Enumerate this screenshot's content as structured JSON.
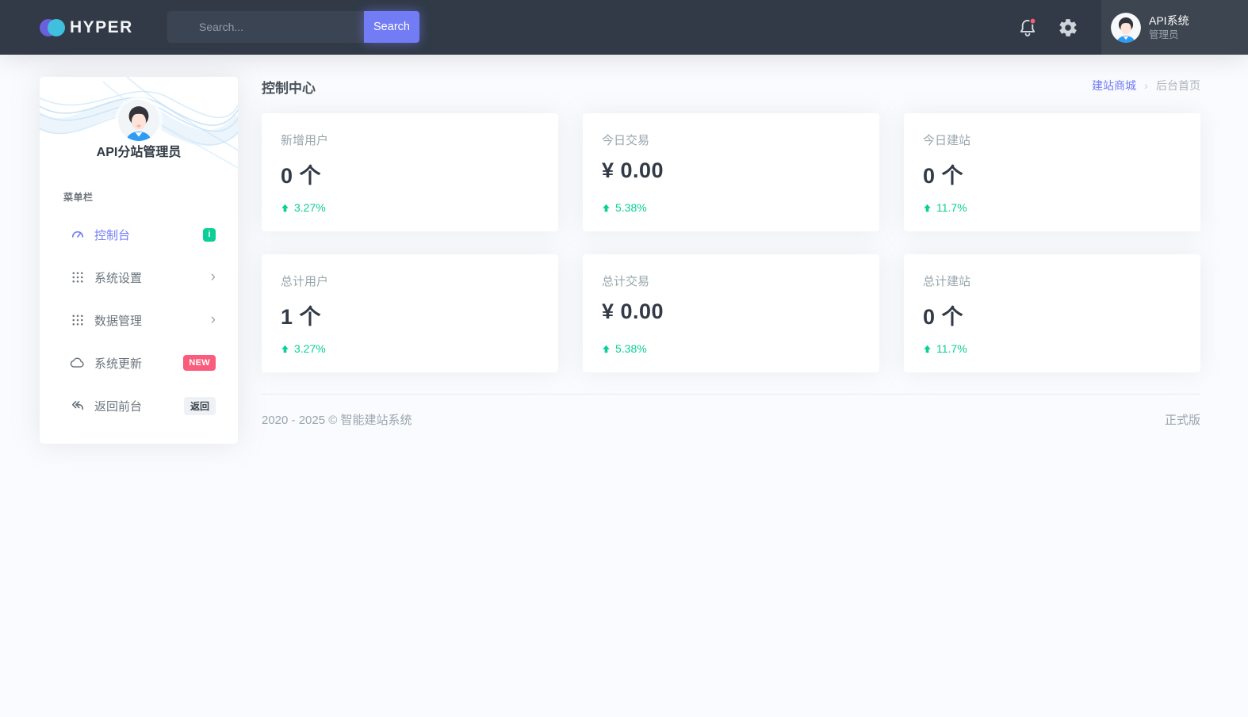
{
  "colors": {
    "primary": "#727cf5",
    "success": "#0acf97",
    "danger": "#fa5c7c",
    "topbar_bg": "#313a46",
    "logo_purple": "#6a5fdd",
    "logo_cyan": "#3fc0de"
  },
  "topbar": {
    "brand": "HYPER",
    "search": {
      "placeholder": "Search...",
      "button_label": "Search"
    },
    "icons": [
      "bell-icon",
      "gear-icon"
    ],
    "user": {
      "name": "API系统",
      "role": "管理员"
    }
  },
  "sidebar": {
    "profile_name": "API分站管理员",
    "section_label": "菜单栏",
    "items": [
      {
        "label": "控制台",
        "icon": "gauge-icon",
        "badge": "i",
        "active": true
      },
      {
        "label": "系统设置",
        "icon": "grid-icon",
        "chevron": "›"
      },
      {
        "label": "数据管理",
        "icon": "grid-icon",
        "chevron": "›"
      },
      {
        "label": "系统更新",
        "icon": "cloud-icon",
        "badge": "NEW"
      },
      {
        "label": "返回前台",
        "icon": "reply-icon",
        "badge": "返回"
      }
    ]
  },
  "page": {
    "title": "控制中心",
    "breadcrumb": {
      "link": "建站商城",
      "separator": "›",
      "current": "后台首页"
    }
  },
  "cards": [
    {
      "label": "新增用户",
      "value": "0 个",
      "change": "3.27%"
    },
    {
      "label": "今日交易",
      "value": "¥ 0.00",
      "change": "5.38%"
    },
    {
      "label": "今日建站",
      "value": "0 个",
      "change": "11.7%"
    },
    {
      "label": "总计用户",
      "value": "1 个",
      "change": "3.27%"
    },
    {
      "label": "总计交易",
      "value": "¥ 0.00",
      "change": "5.38%"
    },
    {
      "label": "总计建站",
      "value": "0 个",
      "change": "11.7%"
    }
  ],
  "footer": {
    "copyright": "2020 - 2025 © 智能建站系统",
    "version": "正式版"
  }
}
